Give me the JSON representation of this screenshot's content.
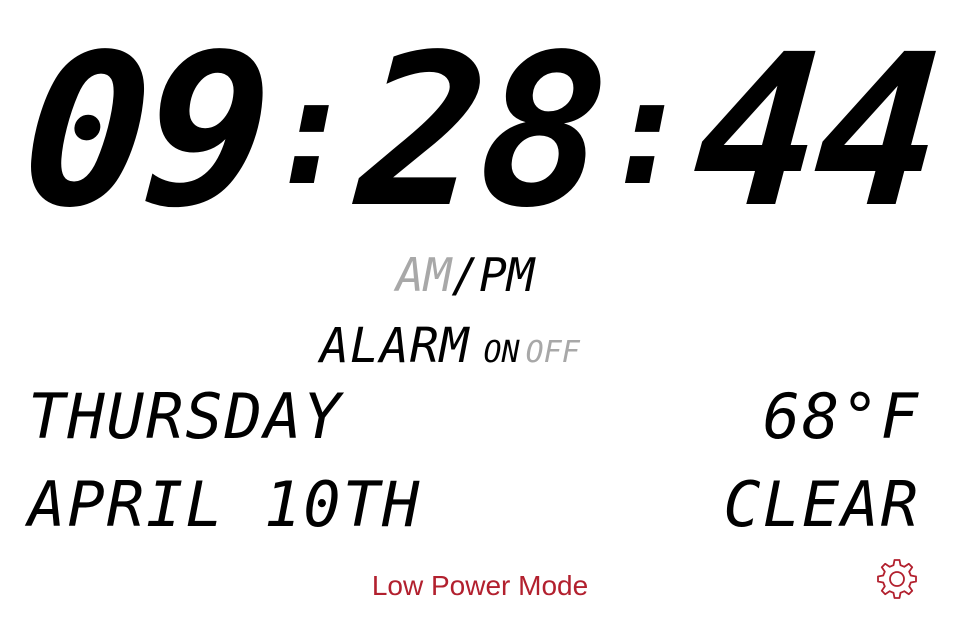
{
  "clock": {
    "hours": "09",
    "minutes": "28",
    "seconds": "44",
    "separator": ":"
  },
  "period": {
    "am": "AM",
    "slash": "/",
    "pm": "PM",
    "active": "PM"
  },
  "alarm": {
    "label": "ALARM",
    "on": "ON",
    "off": "OFF",
    "active": "ON"
  },
  "date": {
    "weekday": "THURSDAY",
    "month_day": "APRIL 10TH"
  },
  "weather": {
    "temperature": "68°F",
    "condition": "CLEAR"
  },
  "status": {
    "low_power_mode": "Low Power Mode"
  },
  "icons": {
    "settings": "gear-icon"
  },
  "colors": {
    "segment_on": "#000000",
    "segment_off": "#a8a8a8",
    "accent": "#b2202e",
    "background": "#ffffff"
  }
}
